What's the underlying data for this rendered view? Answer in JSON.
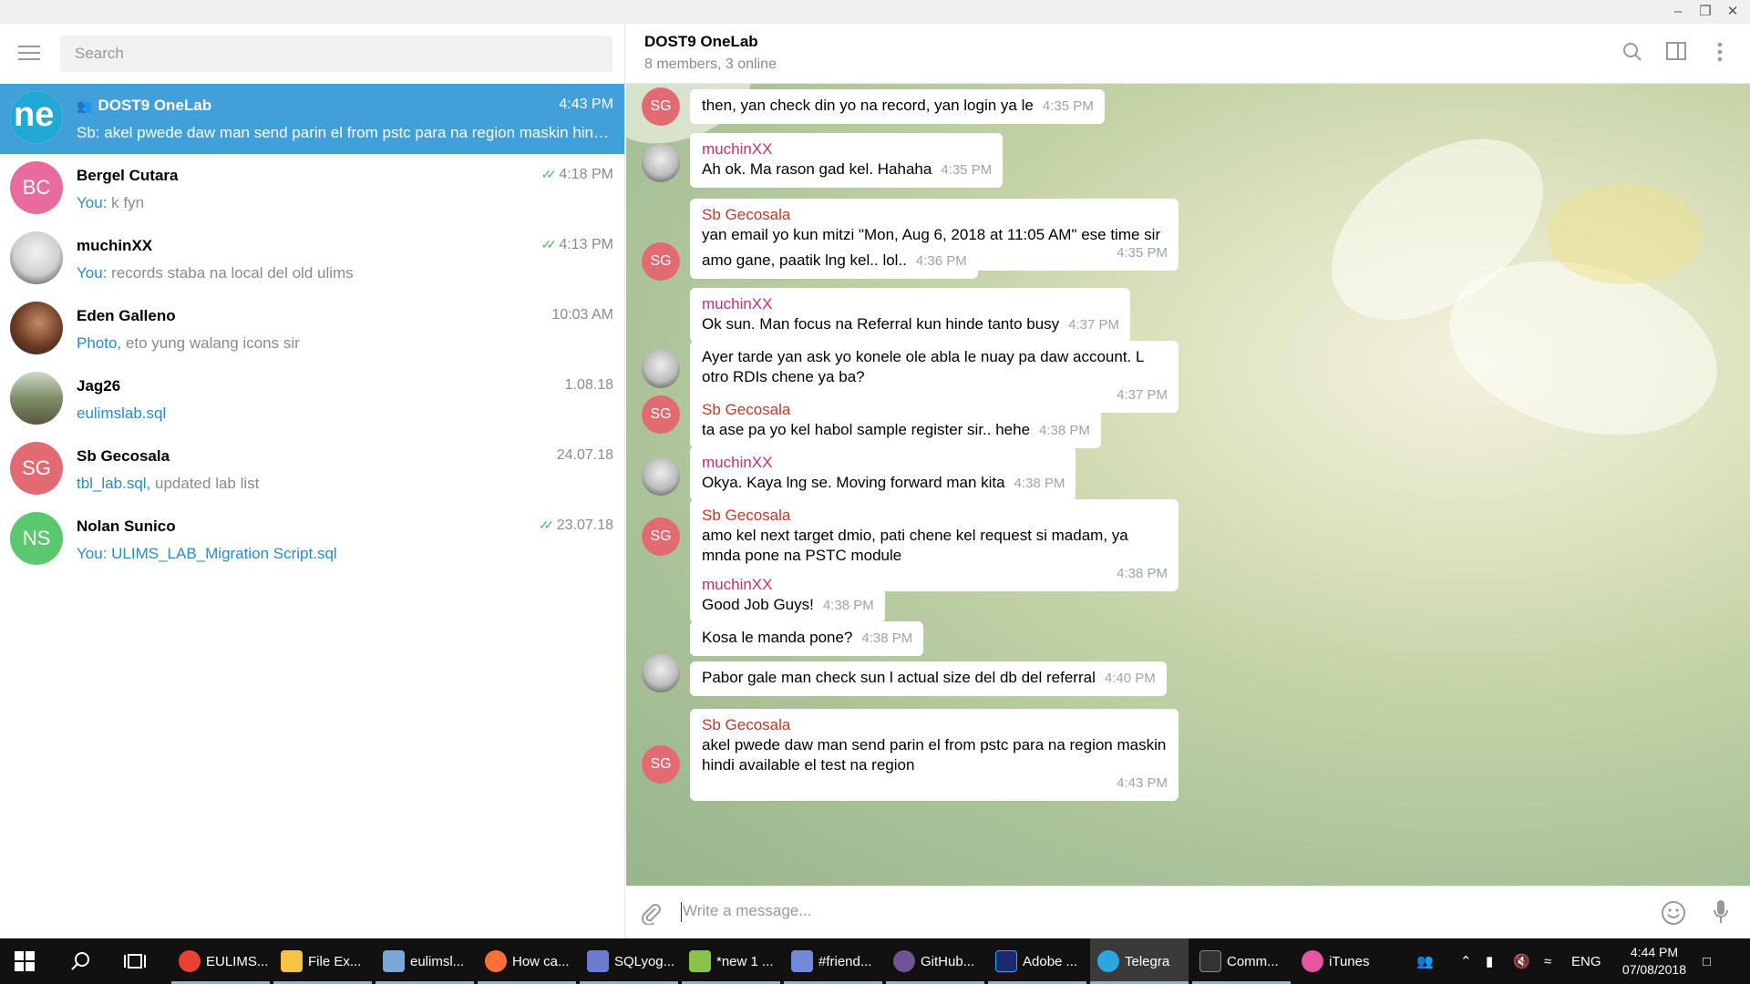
{
  "sidebar": {
    "search_placeholder": "Search",
    "chats": [
      {
        "name": "DOST9 OneLab",
        "time": "4:43 PM",
        "preview_label": "Sb:",
        "preview": "akel pwede daw man send parin el from pstc para na region maskin hindi...",
        "avatar_text": "ne",
        "is_group": true
      },
      {
        "name": "Bergel Cutara",
        "time": "4:18 PM",
        "preview_label": "You:",
        "preview": "k fyn",
        "avatar_text": "BC",
        "read": true
      },
      {
        "name": "muchinXX",
        "time": "4:13 PM",
        "preview_label": "You:",
        "preview": "records staba na local del old ulims",
        "avatar_text": "",
        "read": true
      },
      {
        "name": "Eden Galleno",
        "time": "10:03 AM",
        "preview_label": "Photo,",
        "preview": "eto yung walang icons sir",
        "avatar_text": ""
      },
      {
        "name": "Jag26",
        "time": "1.08.18",
        "preview_label": "eulimslab.sql",
        "preview": "",
        "avatar_text": ""
      },
      {
        "name": "Sb Gecosala",
        "time": "24.07.18",
        "preview_label": "tbl_lab.sql,",
        "preview": "updated lab list",
        "avatar_text": "SG"
      },
      {
        "name": "Nolan Sunico",
        "time": "23.07.18",
        "preview_label": "You: ULIMS_LAB_Migration Script.sql",
        "preview": "",
        "avatar_text": "NS",
        "read": true
      }
    ]
  },
  "chat": {
    "title": "DOST9 OneLab",
    "subtitle": "8 members, 3 online",
    "messages": [
      {
        "sender": "",
        "text": "then, yan check din yo na record, yan login ya le",
        "time": "4:35 PM",
        "avatar": "SG"
      },
      {
        "sender": "muchinXX",
        "text": "Ah ok. Ma rason gad kel. Hahaha",
        "time": "4:35 PM",
        "avatar": ""
      },
      {
        "sender": "Sb Gecosala",
        "text": "yan email yo kun mitzi \"Mon, Aug 6, 2018 at 11:05 AM\" ese time sir",
        "time": "4:35 PM",
        "avatar": ""
      },
      {
        "sender": "",
        "text": "amo gane, paatik lng kel.. lol..",
        "time": "4:36 PM",
        "avatar": "SG"
      },
      {
        "sender": "muchinXX",
        "text": "Ok sun. Man focus na Referral kun hinde tanto busy",
        "time": "4:37 PM",
        "avatar": ""
      },
      {
        "sender": "",
        "text": "Ayer tarde yan ask yo konele ole abla le nuay pa daw account. L otro RDIs chene ya ba?",
        "time": "4:37 PM",
        "avatar": ""
      },
      {
        "sender": "Sb Gecosala",
        "text": "ta ase pa yo kel habol sample register sir.. hehe",
        "time": "4:38 PM",
        "avatar": "SG"
      },
      {
        "sender": "muchinXX",
        "text": "Okya. Kaya lng se.  Moving forward man kita",
        "time": "4:38 PM",
        "avatar": ""
      },
      {
        "sender": "Sb Gecosala",
        "text": "amo kel next target dmio, pati chene kel request si madam, ya mnda pone na PSTC module",
        "time": "4:38 PM",
        "avatar": "SG"
      },
      {
        "sender": "muchinXX",
        "text": "Good Job Guys!",
        "time": "4:38 PM",
        "avatar": ""
      },
      {
        "sender": "",
        "text": "Kosa le manda pone?",
        "time": "4:38 PM",
        "avatar": ""
      },
      {
        "sender": "",
        "text": "Pabor gale man check sun l actual size del db del referral",
        "time": "4:40 PM",
        "avatar": ""
      },
      {
        "sender": "Sb Gecosala",
        "text": "akel pwede daw man send parin el from pstc para na region maskin hindi available el test na region",
        "time": "4:43 PM",
        "avatar": "SG"
      }
    ],
    "composer_placeholder": "Write a message..."
  },
  "taskbar": {
    "apps": [
      {
        "label": "EULIMS...",
        "color": "#e94235"
      },
      {
        "label": "File Ex...",
        "color": "#f6c344"
      },
      {
        "label": "eulimsl...",
        "color": "#7aa6d8"
      },
      {
        "label": "How ca...",
        "color": "#ff7139"
      },
      {
        "label": "SQLyog...",
        "color": "#6c7bd1"
      },
      {
        "label": "*new 1 ...",
        "color": "#8bc34a"
      },
      {
        "label": "#friend...",
        "color": "#7289da"
      },
      {
        "label": "GitHub...",
        "color": "#6e5494"
      },
      {
        "label": "Adobe ...",
        "color": "#1b2a6b"
      },
      {
        "label": "Telegra",
        "color": "#2ca5e0"
      },
      {
        "label": "Comm...",
        "color": "#333333"
      },
      {
        "label": "iTunes",
        "color": "#e655a0"
      }
    ],
    "lang": "ENG",
    "time": "4:44 PM",
    "date": "07/08/2018"
  },
  "colors": {
    "accent": "#419fd9",
    "sender_red": "#c0392b",
    "read_ticks": "#4fbf55",
    "avatar_bc": "#e96a9d",
    "avatar_sg": "#e26a72",
    "avatar_ns": "#5ac86e"
  }
}
